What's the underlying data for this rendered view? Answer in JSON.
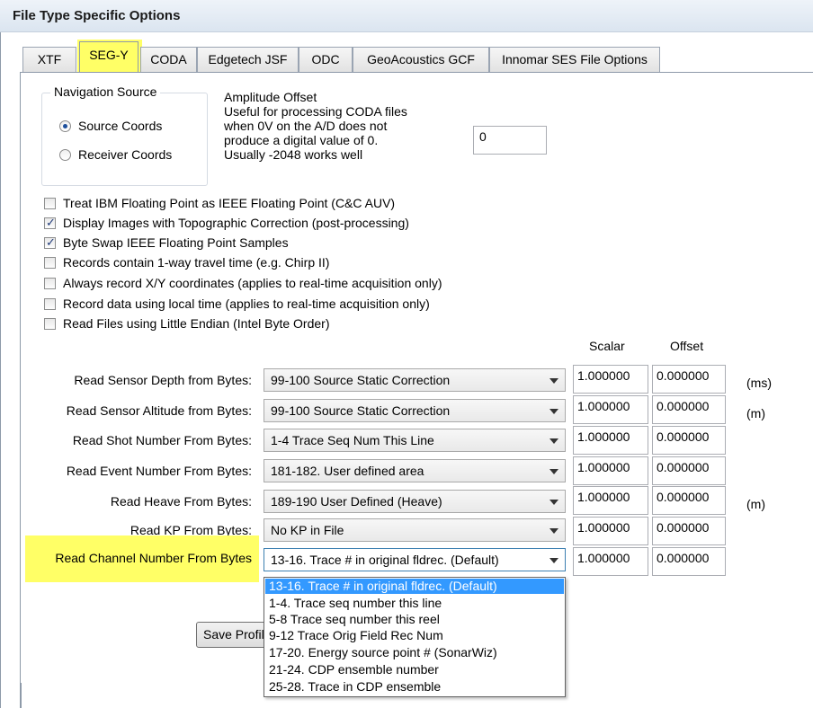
{
  "window": {
    "title": "File Type Specific Options"
  },
  "tabs": [
    {
      "label": "XTF"
    },
    {
      "label": "SEG-Y",
      "active": true
    },
    {
      "label": "CODA"
    },
    {
      "label": "Edgetech JSF"
    },
    {
      "label": "ODC"
    },
    {
      "label": "GeoAcoustics GCF"
    },
    {
      "label": "Innomar SES File Options"
    }
  ],
  "nav_source": {
    "label": "Navigation Source",
    "options": [
      {
        "label": "Source Coords",
        "selected": true
      },
      {
        "label": "Receiver Coords",
        "selected": false
      }
    ]
  },
  "amplitude": {
    "lines": [
      "Amplitude Offset",
      "Useful for processing CODA files",
      "when 0V on the A/D does not",
      "produce a digital value of 0.",
      "Usually -2048 works well"
    ],
    "value": "0"
  },
  "checkboxes": [
    {
      "label": "Treat IBM Floating Point as IEEE Floating Point (C&C AUV)",
      "checked": false
    },
    {
      "label": "Display Images with Topographic Correction (post-processing)",
      "checked": true
    },
    {
      "label": "Byte Swap IEEE Floating Point Samples",
      "checked": true
    },
    {
      "label": "Records contain 1-way travel time (e.g. Chirp II)",
      "checked": false
    },
    {
      "label": "Always record X/Y coordinates (applies to real-time acquisition only)",
      "checked": false
    },
    {
      "label": "Record data using local time (applies to real-time acquisition only)",
      "checked": false
    },
    {
      "label": "Read Files using Little Endian (Intel Byte Order)",
      "checked": false
    }
  ],
  "columns": {
    "scalar": "Scalar",
    "offset": "Offset"
  },
  "rows": [
    {
      "label": "Read Sensor Depth from Bytes:",
      "value": "99-100 Source Static Correction",
      "scalar": "1.000000",
      "offset": "0.000000",
      "unit": "(ms)"
    },
    {
      "label": "Read Sensor Altitude from Bytes:",
      "value": "99-100 Source Static Correction",
      "scalar": "1.000000",
      "offset": "0.000000",
      "unit": "(m)"
    },
    {
      "label": "Read Shot Number From Bytes:",
      "value": "1-4  Trace Seq Num This Line",
      "scalar": "1.000000",
      "offset": "0.000000",
      "unit": ""
    },
    {
      "label": "Read Event Number From Bytes:",
      "value": "181-182. User defined area",
      "scalar": "1.000000",
      "offset": "0.000000",
      "unit": ""
    },
    {
      "label": "Read Heave From Bytes:",
      "value": "189-190 User Defined (Heave)",
      "scalar": "1.000000",
      "offset": "0.000000",
      "unit": "(m)"
    },
    {
      "label": "Read KP From Bytes:",
      "value": "No KP in File",
      "scalar": "1.000000",
      "offset": "0.000000",
      "unit": ""
    },
    {
      "label": "Read Channel Number From Bytes",
      "value": "13-16. Trace # in original fldrec. (Default)",
      "scalar": "1.000000",
      "offset": "0.000000",
      "unit": ""
    }
  ],
  "dropdown_options": [
    "13-16. Trace # in original fldrec. (Default)",
    "1-4. Trace seq number this line",
    "5-8 Trace seq number this reel",
    "9-12 Trace Orig Field Rec Num",
    "17-20. Energy source point # (SonarWiz)",
    "21-24. CDP ensemble number",
    "25-28. Trace in CDP ensemble"
  ],
  "save_button": {
    "label": "Save Profile"
  },
  "colors": {
    "highlight": "#ffff66",
    "selection": "#3399ff"
  }
}
